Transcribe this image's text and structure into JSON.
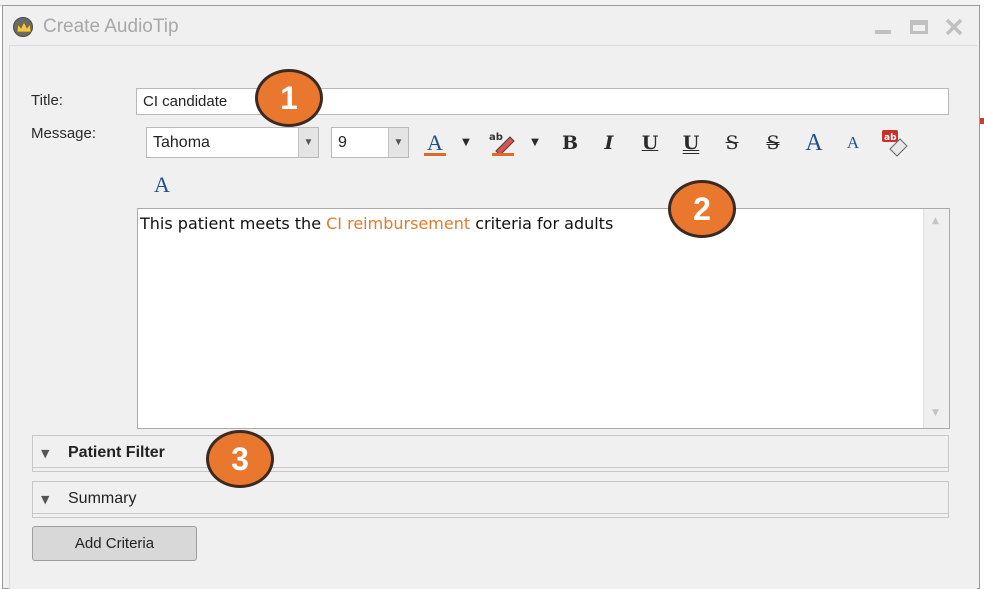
{
  "window": {
    "title": "Create AudioTip"
  },
  "form": {
    "title_label": "Title:",
    "title_value": "CI candidate",
    "message_label": "Message:"
  },
  "toolbar": {
    "font_name": "Tahoma",
    "font_size": "9",
    "bold_glyph": "B",
    "italic_glyph": "I",
    "underline_glyph": "U",
    "double_underline_glyph": "U",
    "strike_glyph": "S",
    "double_strike_glyph": "S",
    "grow_font_glyph": "A",
    "shrink_font_glyph": "A",
    "font_color_glyph": "A",
    "style_glyph": "A",
    "highlight_glyph": "ab",
    "spellcheck_glyph": "ab"
  },
  "message": {
    "before": "This patient meets the ",
    "highlight": "CI reimbursement",
    "after": " criteria for adults"
  },
  "sections": {
    "patient_filter": "Patient Filter",
    "summary": "Summary"
  },
  "buttons": {
    "add_criteria": "Add Criteria"
  },
  "callouts": [
    "1",
    "2",
    "3"
  ],
  "colors": {
    "callout_fill": "#e9772e",
    "highlight_text": "#e07b2e",
    "font_color_bar": "#e0682a"
  },
  "icons": {
    "app": "crown-icon",
    "font_color": "font-color-icon",
    "highlight": "highlighter-icon",
    "spellcheck": "spellcheck-eraser-icon"
  }
}
